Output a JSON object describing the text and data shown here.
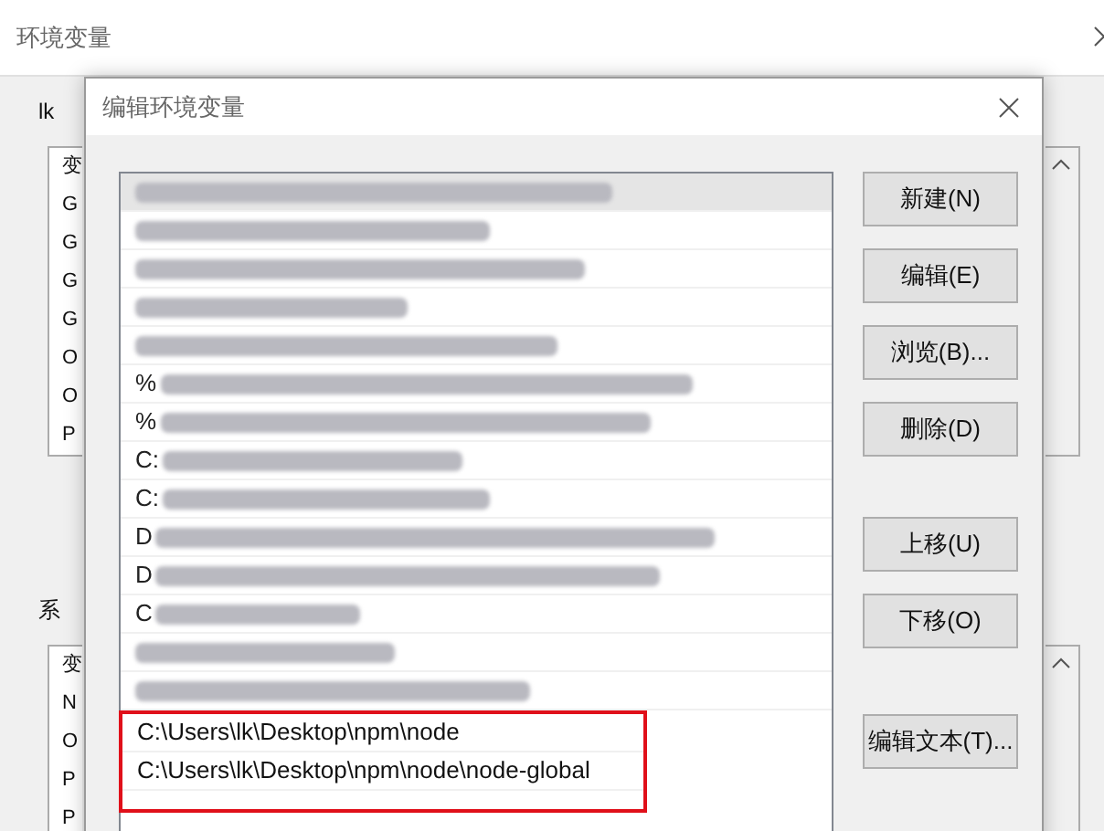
{
  "back_window": {
    "title": "环境变量",
    "user_group": {
      "label": "lk",
      "items": [
        "变",
        "G",
        "G",
        "G",
        "G",
        "O",
        "O",
        "P"
      ]
    },
    "system_group": {
      "label": "系",
      "items": [
        "变",
        "N",
        "O",
        "P",
        "P"
      ]
    }
  },
  "dialog": {
    "title": "编辑环境变量",
    "entries": [
      {
        "kind": "redacted",
        "selected": true
      },
      {
        "kind": "redacted",
        "selected": false
      },
      {
        "kind": "redacted",
        "selected": false
      },
      {
        "kind": "redacted",
        "selected": false
      },
      {
        "kind": "redacted",
        "selected": false
      },
      {
        "kind": "redacted",
        "prefix": "%",
        "selected": false
      },
      {
        "kind": "redacted",
        "prefix": "%",
        "selected": false
      },
      {
        "kind": "redacted",
        "prefix": "C:",
        "selected": false
      },
      {
        "kind": "redacted",
        "prefix": "C:",
        "selected": false
      },
      {
        "kind": "redacted",
        "prefix": "D",
        "selected": false
      },
      {
        "kind": "redacted",
        "prefix": "D",
        "selected": false
      },
      {
        "kind": "redacted",
        "prefix": "C",
        "selected": false
      },
      {
        "kind": "redacted",
        "selected": false
      },
      {
        "kind": "redacted",
        "selected": false
      },
      {
        "kind": "text",
        "text": "C:\\Users\\lk\\Desktop\\npm\\node",
        "selected": false,
        "highlighted": true
      },
      {
        "kind": "text",
        "text": "C:\\Users\\lk\\Desktop\\npm\\node\\node-global",
        "selected": false,
        "highlighted": true
      }
    ],
    "buttons_top": [
      "新建(N)",
      "编辑(E)",
      "浏览(B)...",
      "删除(D)"
    ],
    "buttons_move": [
      "上移(U)",
      "下移(O)"
    ],
    "buttons_bottom": [
      "编辑文本(T)..."
    ]
  }
}
